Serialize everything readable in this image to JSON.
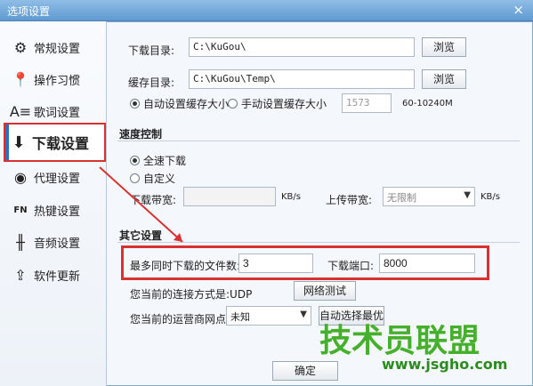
{
  "window": {
    "title": "选项设置",
    "close_glyph": "×"
  },
  "sidebar": {
    "items": [
      {
        "label": "常规设置",
        "icon": "gear-icon",
        "glyph": "⚙"
      },
      {
        "label": "操作习惯",
        "icon": "pin-icon",
        "glyph": "📍"
      },
      {
        "label": "歌词设置",
        "icon": "lyrics-icon",
        "glyph": "A≡"
      },
      {
        "label": "下载设置",
        "icon": "download-icon",
        "glyph": "⬇"
      },
      {
        "label": "代理设置",
        "icon": "globe-icon",
        "glyph": "◉"
      },
      {
        "label": "热键设置",
        "icon": "keyboard-icon",
        "glyph": "FN"
      },
      {
        "label": "音频设置",
        "icon": "equalizer-icon",
        "glyph": "╫"
      },
      {
        "label": "软件更新",
        "icon": "update-icon",
        "glyph": "⇪"
      }
    ],
    "active_index": 3
  },
  "download": {
    "dir_label": "下载目录:",
    "dir_value": "C:\\KuGou\\",
    "browse1": "浏览",
    "cache_label": "缓存目录:",
    "cache_value": "C:\\KuGou\\Temp\\",
    "browse2": "浏览",
    "auto_cache": "自动设置缓存大小",
    "manual_cache": "手动设置缓存大小",
    "cache_size": "1573",
    "cache_range": "60-10240M"
  },
  "speed": {
    "section": "速度控制",
    "full_speed": "全速下载",
    "custom": "自定义",
    "download_bw_label": "下载带宽:",
    "download_bw_value": "",
    "kbs1": "KB/s",
    "upload_bw_label": "上传带宽:",
    "upload_bw_value": "无限制",
    "kbs2": "KB/s"
  },
  "other": {
    "section": "其它设置",
    "max_files_label": "最多同时下载的文件数:",
    "max_files_value": "3",
    "port_label": "下载端口:",
    "port_value": "8000",
    "connection_label": "您当前的连接方式是:UDP",
    "network_test": "网络测试",
    "isp_label": "您当前的运营商网点:",
    "isp_value": "未知",
    "auto_select": "自动选择最优"
  },
  "footer": {
    "ok": "确定"
  },
  "watermark": {
    "main": "技术员联盟",
    "sub": "www.jsgho.com"
  }
}
